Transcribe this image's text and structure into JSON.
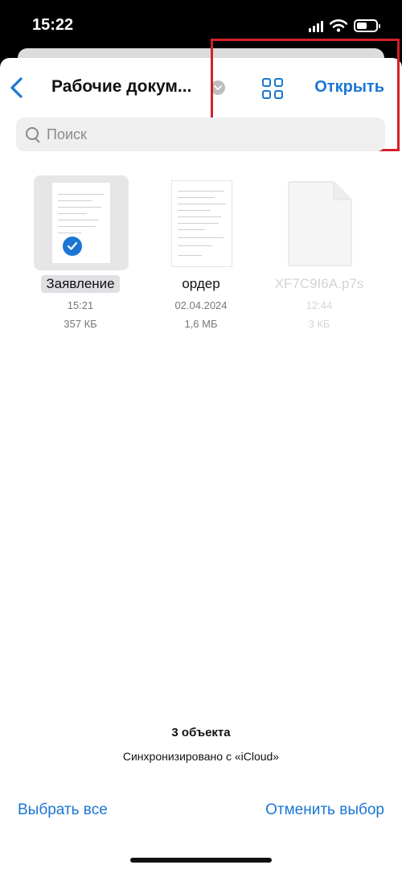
{
  "status": {
    "time": "15:22"
  },
  "nav": {
    "title": "Рабочие докум...",
    "open_label": "Открыть"
  },
  "search": {
    "placeholder": "Поиск"
  },
  "files": [
    {
      "name": "Заявление",
      "time": "15:21",
      "size": "357 КБ",
      "selected": true
    },
    {
      "name": "ордер",
      "time": "02.04.2024",
      "size": "1,6 МБ",
      "selected": false
    },
    {
      "name": "XF7C9I6A.p7s",
      "time": "12:44",
      "size": "3 КБ",
      "selected": false
    }
  ],
  "footer": {
    "count": "3 объекта",
    "sync": "Синхронизировано с «iCloud»"
  },
  "toolbar": {
    "select_all": "Выбрать все",
    "deselect": "Отменить выбор"
  },
  "colors": {
    "accent": "#1b76d3",
    "highlight": "#d3202a"
  }
}
